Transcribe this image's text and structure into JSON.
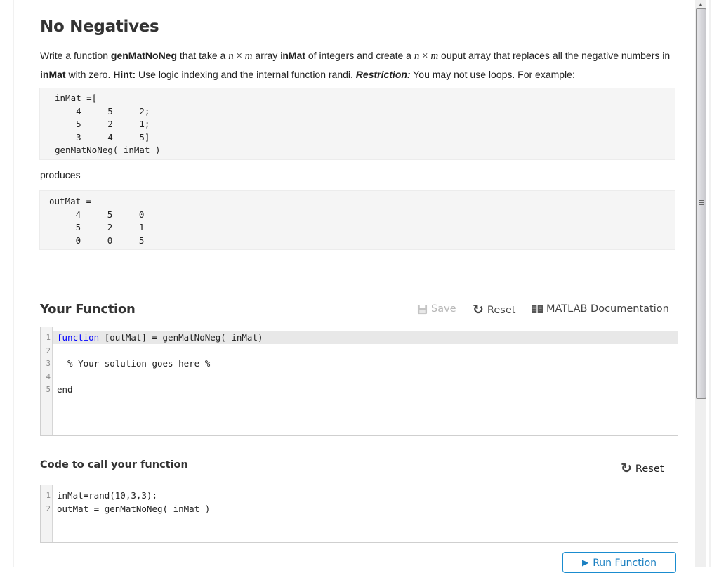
{
  "problem": {
    "title": "No Negatives",
    "desc": {
      "p1": "Write a function ",
      "fn": "genMatNoNeg",
      "p2": " that take a ",
      "n": "n",
      "times": "×",
      "m": "m",
      "p3": " array i",
      "inmat1": "nMat",
      "p4": " of integers and create a ",
      "p5": "  ouput array that replaces all the negative numbers in ",
      "inmat2": "inMat",
      "p6": " with zero.   ",
      "hint_label": "Hint:",
      "p7": " Use logic indexing and the internal function randi.  ",
      "restriction_label": "Restriction:",
      "p8": "  You may not use loops.  For example:"
    },
    "example_input": "inMat =[\n    4     5    -2;\n    5     2     1;\n   -3    -4     5]\ngenMatNoNeg( inMat )",
    "produces": "produces",
    "example_output": "outMat =\n     4     5     0\n     5     2     1\n     0     0     5"
  },
  "your_function": {
    "title": "Your Function",
    "toolbar": {
      "save": "Save",
      "reset": "Reset",
      "docs": "MATLAB Documentation"
    },
    "lines": [
      {
        "n": "1",
        "kw": "function",
        "rest": " [outMat] = genMatNoNeg( inMat)"
      },
      {
        "n": "2",
        "text": ""
      },
      {
        "n": "3",
        "comment": "  % Your solution goes here %"
      },
      {
        "n": "4",
        "text": ""
      },
      {
        "n": "5",
        "kw": "end"
      }
    ]
  },
  "call_code": {
    "title": "Code to call your function",
    "reset": "Reset",
    "lines": [
      {
        "n": "1",
        "text": "inMat=rand(10,3,3);"
      },
      {
        "n": "2",
        "text": "outMat = genMatNoNeg( inMat )"
      }
    ],
    "run_button": "Run Function"
  },
  "icons": {
    "save": "floppy-disk-icon",
    "reset": "refresh-icon",
    "docs": "book-icon",
    "run": "play-icon"
  },
  "colors": {
    "keyword": "#0000ff",
    "comment": "#228b22",
    "run_button": "#1a8ccf",
    "save_disabled": "#b8b8b8"
  }
}
